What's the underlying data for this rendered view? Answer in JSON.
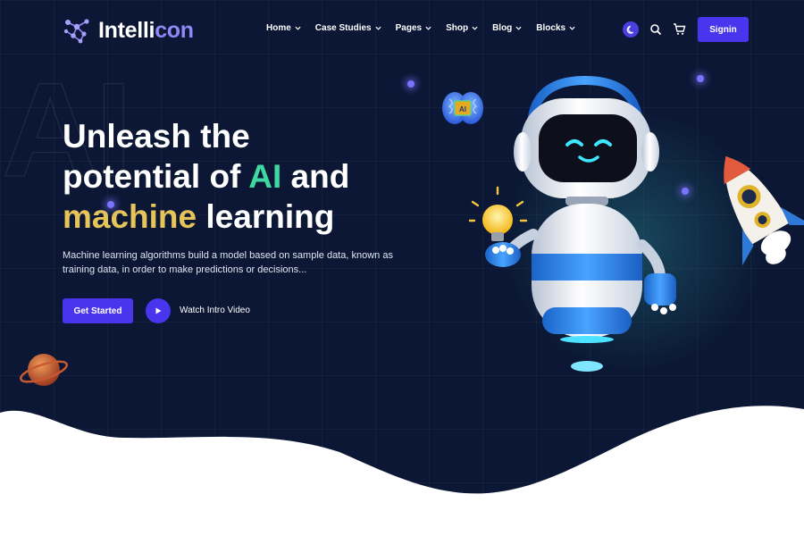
{
  "brand": {
    "name_part1": "Intelli",
    "name_part2": "con"
  },
  "nav": {
    "items": [
      {
        "label": "Home"
      },
      {
        "label": "Case Studies"
      },
      {
        "label": "Pages"
      },
      {
        "label": "Shop"
      },
      {
        "label": "Blog"
      },
      {
        "label": "Blocks"
      }
    ]
  },
  "header": {
    "signin_label": "Signin",
    "icons": [
      "moon-icon",
      "search-icon",
      "cart-icon"
    ]
  },
  "hero": {
    "bg_text": "AI",
    "headline_line1": "Unleash the",
    "headline_line2_a": "potential of ",
    "headline_line2_b": "AI",
    "headline_line2_c": " and",
    "headline_line3_a": "machine",
    "headline_line3_b": " learning",
    "description": "Machine learning algorithms build a model based on sample data, known as training data, in order to make predictions or decisions...",
    "cta_label": "Get Started",
    "video_label": "Watch Intro Video",
    "brain_chip_label": "AI"
  },
  "colors": {
    "background": "#0b1734",
    "accent": "#4a35ef",
    "highlight_green": "#3ed8a0",
    "highlight_yellow": "#e6c459"
  }
}
